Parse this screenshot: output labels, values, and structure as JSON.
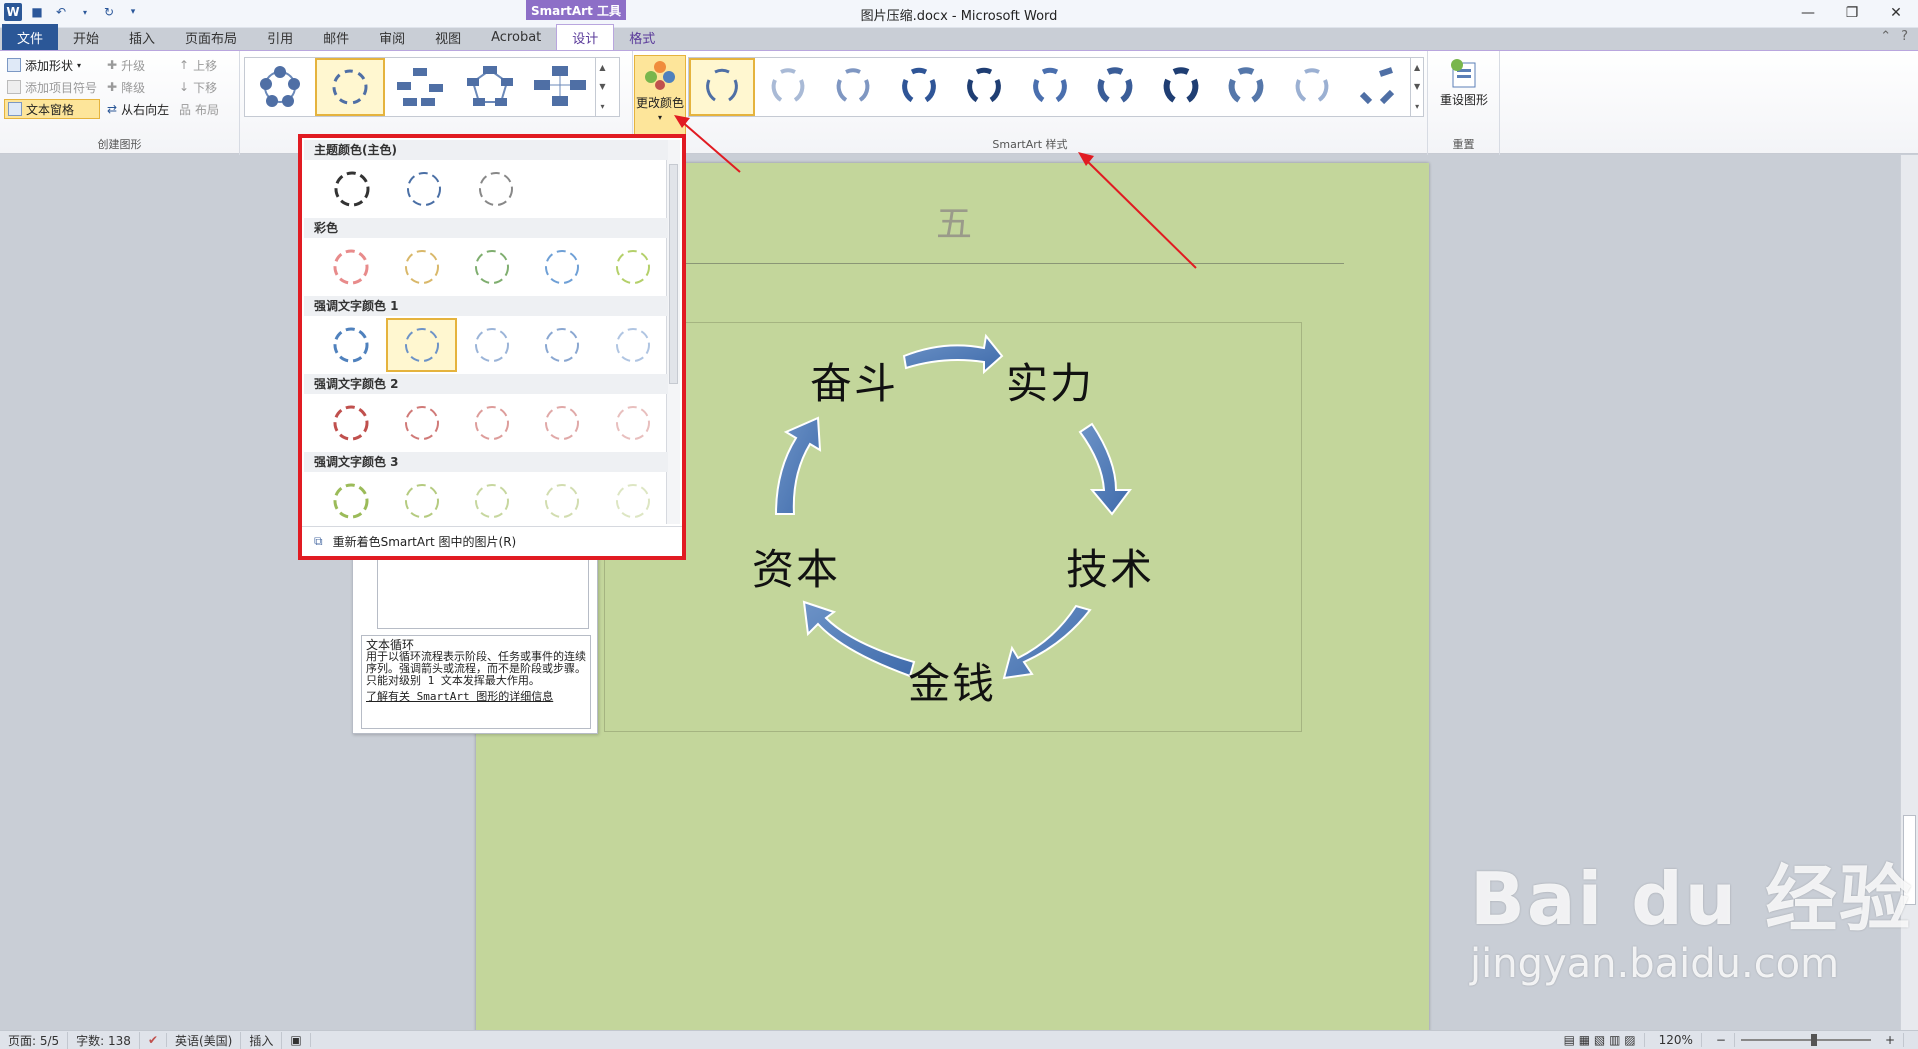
{
  "window": {
    "title": "图片压缩.docx - Microsoft Word",
    "context_tool": "SmartArt 工具"
  },
  "tabs": [
    {
      "label": "文件"
    },
    {
      "label": "开始"
    },
    {
      "label": "插入"
    },
    {
      "label": "页面布局"
    },
    {
      "label": "引用"
    },
    {
      "label": "邮件"
    },
    {
      "label": "审阅"
    },
    {
      "label": "视图"
    },
    {
      "label": "Acrobat"
    },
    {
      "label": "设计"
    },
    {
      "label": "格式"
    }
  ],
  "ribbon": {
    "create_group": {
      "label": "创建图形",
      "add_shape": "添加形状",
      "add_bullet": "添加项目符号",
      "text_pane": "文本窗格",
      "promote": "升级",
      "demote": "降级",
      "right_to_left": "从右向左",
      "move_up": "上移",
      "move_down": "下移",
      "layout": "布局"
    },
    "change_colors": "更改颜色",
    "styles_group_label": "SmartArt 样式",
    "reset_group": {
      "label": "重置",
      "reset_graphic": "重设图形"
    }
  },
  "color_menu": {
    "sections": [
      {
        "title": "主题颜色(主色)",
        "colors": [
          "#333333",
          "#4a6fa5",
          "#888888"
        ]
      },
      {
        "title": "彩色",
        "colors": [
          "#e88b8b",
          "#d9b86a",
          "#7fae6f",
          "#6fa0d6",
          "#b4d06a"
        ]
      },
      {
        "title": "强调文字颜色 1",
        "colors": [
          "#4f81bd",
          "#6d93c7",
          "#9bb4d8",
          "#8aa7d1",
          "#b0c5e2"
        ]
      },
      {
        "title": "强调文字颜色 2",
        "colors": [
          "#c0504d",
          "#d07a78",
          "#dd9d9b",
          "#e0a9a8",
          "#e8bfbe"
        ]
      },
      {
        "title": "强调文字颜色 3",
        "colors": [
          "#9bbb59",
          "#b5cb80",
          "#c7d79f",
          "#d2ddb0",
          "#dde6c3"
        ]
      }
    ],
    "footer": "重新着色SmartArt 图中的图片(R)"
  },
  "document": {
    "heading": "五",
    "smartart_words": [
      "奋斗",
      "实力",
      "技术",
      "金钱",
      "资本"
    ]
  },
  "text_pane": {
    "title": "文本循环",
    "description": "用于以循环流程表示阶段、任务或事件的连续序列。强调箭头或流程，而不是阶段或步骤。只能对级别 1 文本发挥最大作用。",
    "link": "了解有关 SmartArt 图形的详细信息"
  },
  "status": {
    "page": "页面: 5/5",
    "words": "字数: 138",
    "language": "英语(美国)",
    "mode": "插入",
    "zoom": "120%"
  },
  "watermark": {
    "brand": "Bai du 经验",
    "url": "jingyan.baidu.com"
  }
}
